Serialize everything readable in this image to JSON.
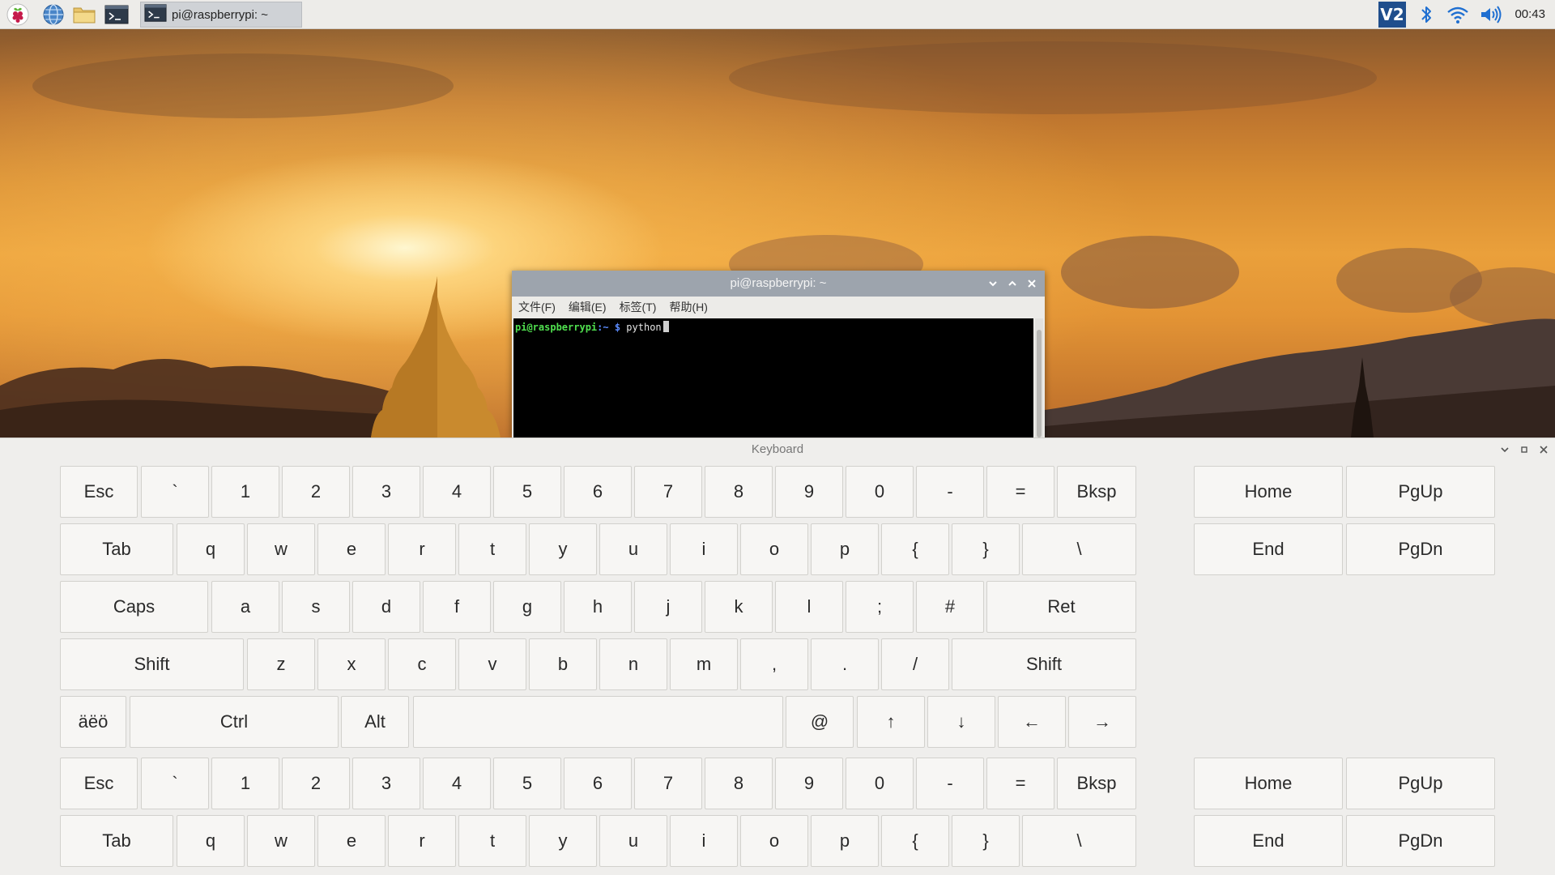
{
  "panel": {
    "task_label": "pi@raspberrypi: ~",
    "clock": "00:43",
    "tray_vnc_label": "V2"
  },
  "terminal": {
    "title": "pi@raspberrypi: ~",
    "menu": [
      "文件(F)",
      "编辑(E)",
      "标签(T)",
      "帮助(H)"
    ],
    "prompt_user": "pi@raspberrypi",
    "prompt_path": ":~ $",
    "command": "python"
  },
  "keyboard": {
    "title": "Keyboard",
    "main_keys": [
      [
        "Esc",
        "`",
        "1",
        "2",
        "3",
        "4",
        "5",
        "6",
        "7",
        "8",
        "9",
        "0",
        "-",
        "=",
        "Bksp"
      ],
      [
        "Tab",
        "q",
        "w",
        "e",
        "r",
        "t",
        "y",
        "u",
        "i",
        "o",
        "p",
        "{",
        "}",
        "\\"
      ],
      [
        "Caps",
        "a",
        "s",
        "d",
        "f",
        "g",
        "h",
        "j",
        "k",
        "l",
        ";",
        "#",
        "Ret"
      ],
      [
        "Shift",
        "z",
        "x",
        "c",
        "v",
        "b",
        "n",
        "m",
        ",",
        ".",
        "/",
        "Shift"
      ],
      [
        "äëö",
        "Ctrl",
        "Alt",
        "",
        "@",
        "↑",
        "↓",
        "←",
        "→"
      ],
      [
        "Esc",
        "`",
        "1",
        "2",
        "3",
        "4",
        "5",
        "6",
        "7",
        "8",
        "9",
        "0",
        "-",
        "=",
        "Bksp"
      ],
      [
        "Tab",
        "q",
        "w",
        "e",
        "r",
        "t",
        "y",
        "u",
        "i",
        "o",
        "p",
        "{",
        "}",
        "\\"
      ]
    ],
    "nav_keys": [
      [
        "Home",
        "PgUp"
      ],
      [
        "End",
        "PgDn"
      ],
      [
        "Home",
        "PgUp"
      ],
      [
        "End",
        "PgDn"
      ]
    ]
  }
}
